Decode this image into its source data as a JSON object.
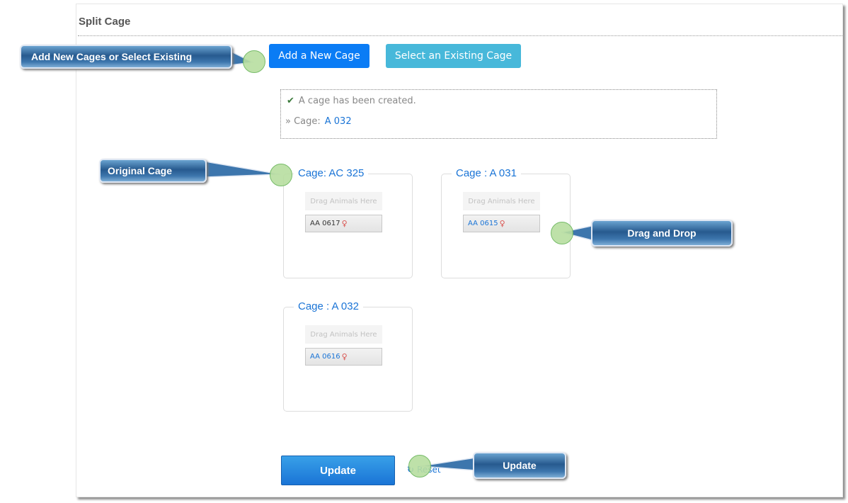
{
  "page": {
    "title": "Split Cage"
  },
  "toolbar": {
    "add_label": "Add a New Cage",
    "select_label": "Select an Existing Cage"
  },
  "message": {
    "text": "A cage has been created.",
    "prefix": "» Cage:",
    "cage_link": "A 032",
    "check_icon": "✔"
  },
  "cages": [
    {
      "legend": "Cage: AC 325",
      "drop_hint": "Drag Animals Here",
      "animal": "AA 0617",
      "sex": "♀"
    },
    {
      "legend": "Cage : A 031",
      "drop_hint": "Drag Animals Here",
      "animal": "AA 0615",
      "sex": "♀"
    },
    {
      "legend": "Cage : A 032",
      "drop_hint": "Drag Animals Here",
      "animal": "AA 0616",
      "sex": "♀"
    }
  ],
  "actions": {
    "update_label": "Update",
    "reset_label": "Reset",
    "reset_icon": "↻"
  },
  "callouts": {
    "add": "Add New Cages or Select Existing",
    "original": "Original Cage",
    "drag": "Drag and Drop",
    "update": "Update"
  },
  "colors": {
    "primary": "#0a7cf5",
    "info": "#47b8da",
    "link": "#1a74d6",
    "callout": "#275a8f"
  }
}
